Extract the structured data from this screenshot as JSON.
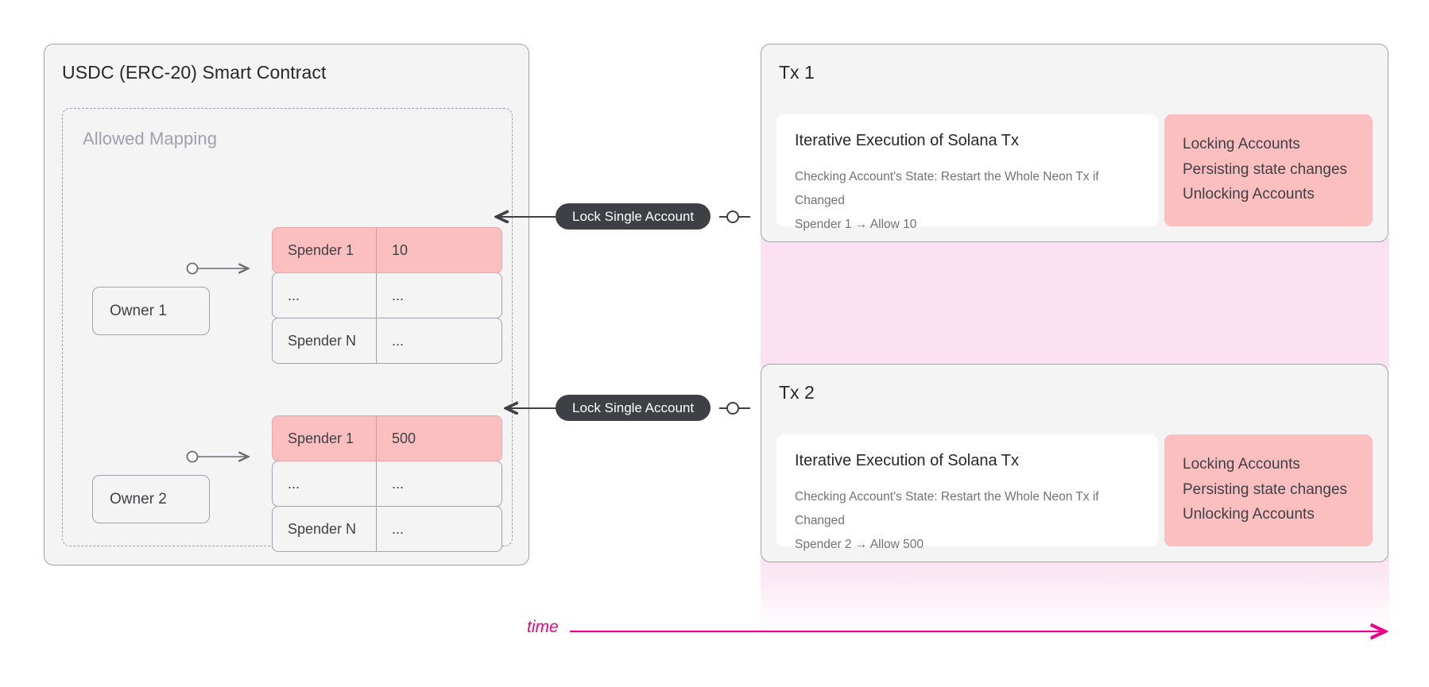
{
  "contract": {
    "title": "USDC (ERC-20) Smart Contract",
    "mapping_title": "Allowed Mapping",
    "owners": [
      {
        "label": "Owner 1"
      },
      {
        "label": "Owner 2"
      }
    ],
    "tables": [
      {
        "owner": "Owner 1",
        "rows": [
          {
            "key": "Spender 1",
            "value": "10",
            "highlighted": true
          },
          {
            "key": "...",
            "value": "...",
            "highlighted": false
          },
          {
            "key": "Spender N",
            "value": "...",
            "highlighted": false
          }
        ]
      },
      {
        "owner": "Owner 2",
        "rows": [
          {
            "key": "Spender 1",
            "value": "500",
            "highlighted": true
          },
          {
            "key": "...",
            "value": "...",
            "highlighted": false
          },
          {
            "key": "Spender N",
            "value": "...",
            "highlighted": false
          }
        ]
      }
    ]
  },
  "locks": [
    {
      "label": "Lock Single Account"
    },
    {
      "label": "Lock Single Account"
    }
  ],
  "transactions": [
    {
      "title": "Tx 1",
      "execution": {
        "title": "Iterative Execution of Solana Tx",
        "line1": "Checking Account's State: Restart the Whole Neon Tx if Changed",
        "line2": "Spender 1 → Allow 10"
      },
      "actions": [
        "Locking Accounts",
        "Persisting state changes",
        "Unlocking Accounts"
      ]
    },
    {
      "title": "Tx 2",
      "execution": {
        "title": "Iterative Execution of Solana Tx",
        "line1": "Checking Account's State: Restart the Whole Neon Tx if Changed",
        "line2": "Spender 2 → Allow 500"
      },
      "actions": [
        "Locking Accounts",
        "Persisting state changes",
        "Unlocking Accounts"
      ]
    }
  ],
  "timeline": {
    "label": "time"
  },
  "colors": {
    "highlight_pink": "#FBBFBF",
    "band_pink": "#FBE1F2",
    "timeline_magenta": "#EC008C",
    "panel_bg": "#F4F4F5",
    "border_gray": "#A1A1AA",
    "pill_dark": "#3F3F46",
    "text_dark": "#27272A",
    "text_muted": "#71717A",
    "mapping_label": "#A1A0AD"
  }
}
